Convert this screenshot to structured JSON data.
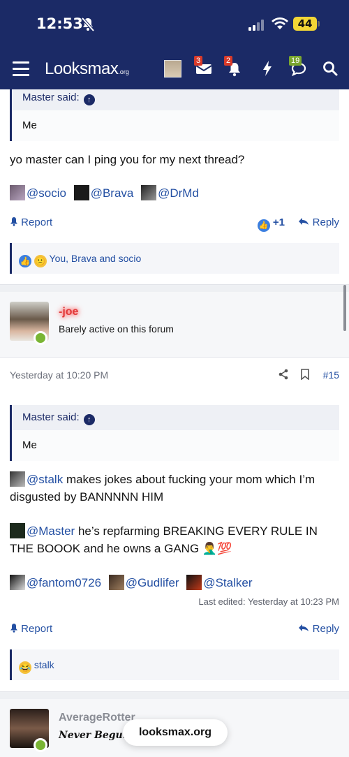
{
  "status": {
    "time": "12:53",
    "battery": "44"
  },
  "nav": {
    "logo_main": "Looksmax",
    "logo_suffix": ".org",
    "badges": {
      "inbox": "3",
      "alerts": "2",
      "conversations": "19"
    }
  },
  "post1": {
    "quote_author": "Master said:",
    "quote_text": "Me",
    "message": "yo master can I ping you for my next thread?",
    "mentions": [
      "@socio",
      "@Brava",
      "@DrMd"
    ],
    "report": "Report",
    "plus": "+1",
    "reply": "Reply",
    "reactions_text": "You, Brava and socio"
  },
  "user2": {
    "name": "-joe",
    "title": "Barely active on this forum"
  },
  "post2": {
    "date": "Yesterday at 10:20 PM",
    "post_number": "#15",
    "quote_author": "Master said:",
    "quote_text": "Me",
    "line1_mention": "@stalk",
    "line1_text": " makes jokes about fucking your mom which I’m disgusted by BANNNNN HIM",
    "line2_mention": "@Master",
    "line2_text": " he’s repfarming BREAKING EVERY RULE IN THE BOOOK and he owns a GANG",
    "line2_emoji": "🤦‍♂️💯",
    "mentions": [
      "@fantom0726",
      "@Gudlifer",
      "@Stalker"
    ],
    "last_edited": "Last edited: Yesterday at 10:23 PM",
    "report": "Report",
    "reply": "Reply",
    "reactions_text": "stalk"
  },
  "user3": {
    "name": "AverageRotter",
    "title": "Never Begun"
  },
  "toast": "looksmax.org",
  "colors": {
    "header": "#1b2a66",
    "link": "#2450a3",
    "online": "#7ab534"
  }
}
